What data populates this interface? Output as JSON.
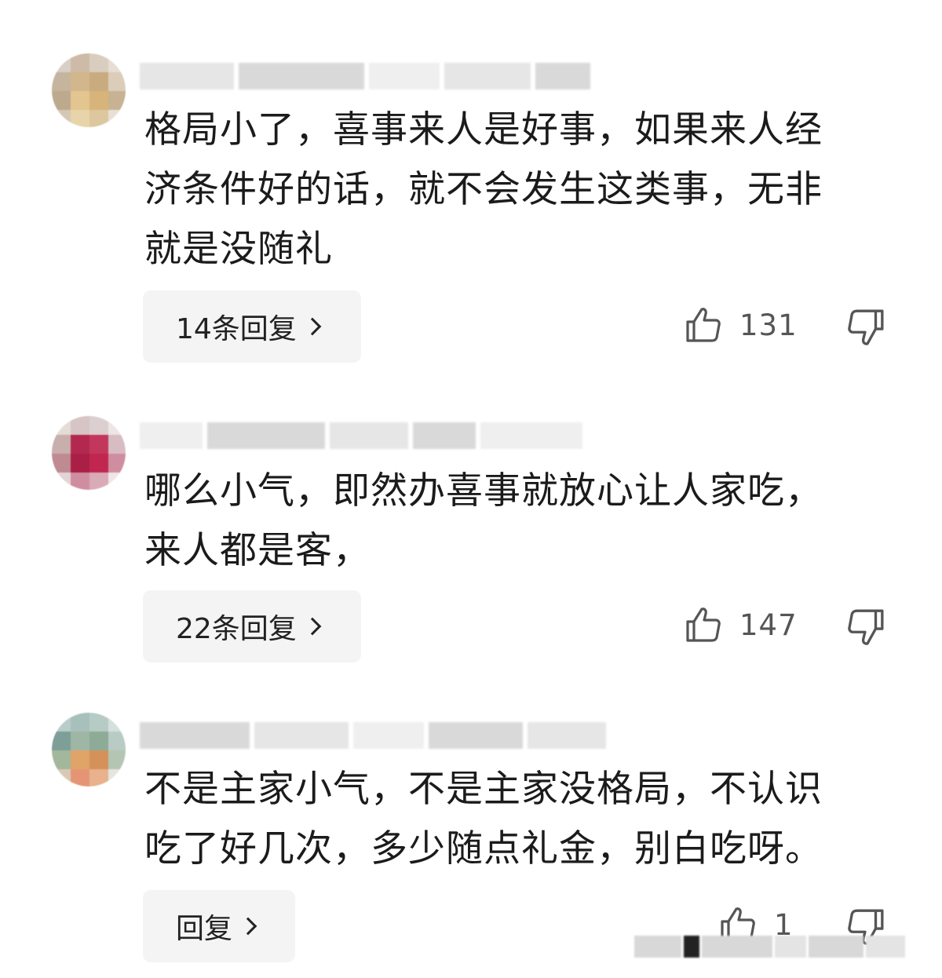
{
  "comments": [
    {
      "text": "格局小了，喜事来人是好事，如果来人经\n济条件好的话，就不会发生这类事，无非\n就是没随礼",
      "replies_label": "14条回复",
      "likes": "131"
    },
    {
      "text": "哪么小气，即然办喜事就放心让人家吃，\n来人都是客，",
      "replies_label": "22条回复",
      "likes": "147"
    },
    {
      "text": "不是主家小气，不是主家没格局，不认识\n吃了好几次，多少随点礼金，别白吃呀。",
      "replies_label": "回复",
      "likes": "1"
    }
  ],
  "icons": {
    "like": "thumbs-up-icon",
    "dislike": "thumbs-down-icon",
    "chevron": "chevron-right-icon"
  },
  "colors": {
    "text": "#1b1b1b",
    "button_bg": "#f4f4f4",
    "icon": "#555555"
  }
}
